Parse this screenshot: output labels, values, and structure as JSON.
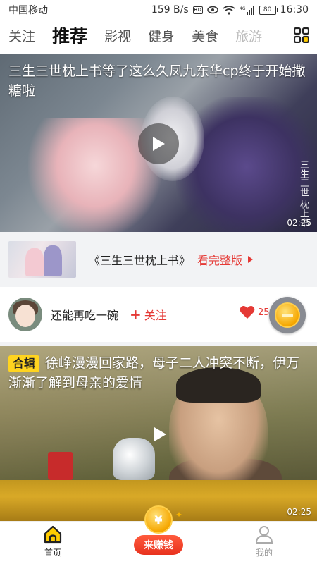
{
  "status_bar": {
    "carrier": "中国移动",
    "speed": "159 B/s",
    "hd_label": "HD",
    "network": "4G",
    "battery": "80",
    "time": "16:30"
  },
  "tabs": [
    "关注",
    "推荐",
    "影视",
    "健身",
    "美食",
    "旅游"
  ],
  "active_tab_index": 1,
  "feed": {
    "video1": {
      "title": "三生三世枕上书等了这么久凤九东华cp终于开始撒糖啦",
      "duration": "02:25",
      "watermark": "三生三世 枕上书"
    },
    "drama": {
      "title": "《三生三世枕上书》",
      "link": "看完整版"
    },
    "author": {
      "name": "还能再吃一碗",
      "follow": "关注",
      "like_count": "25"
    },
    "video2": {
      "badge": "合辑",
      "title": "徐峥漫漫回家路，母子二人冲突不断，伊万渐渐了解到母亲的爱情",
      "duration": "02:25"
    }
  },
  "bottom_nav": {
    "home": "首页",
    "earn": "来赚钱",
    "coin_symbol": "¥",
    "mine": "我的"
  },
  "colors": {
    "accent_red": "#e53935",
    "badge_yellow": "#ffd41f",
    "coin_gold": "#f6a700"
  }
}
